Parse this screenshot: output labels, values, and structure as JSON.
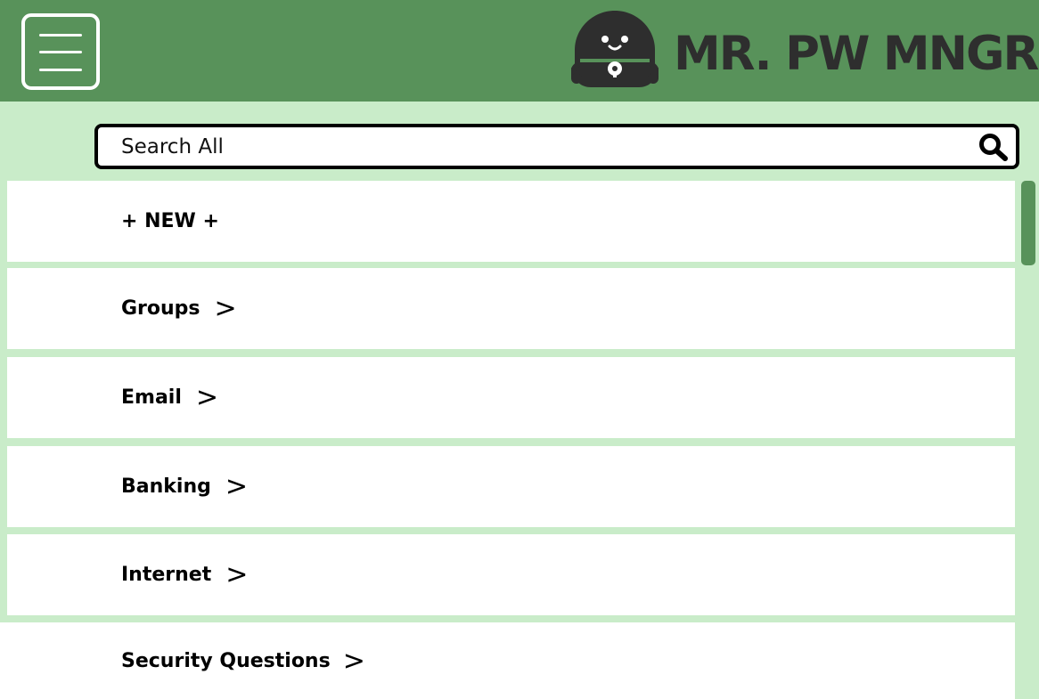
{
  "header": {
    "title": "MR. PW MNGR",
    "menu_icon": "hamburger-menu-icon",
    "logo_icon": "lock-mascot-icon",
    "background_color": "#58925a",
    "title_color": "#2e2e2e"
  },
  "search": {
    "placeholder": "Search All",
    "icon": "search-icon"
  },
  "list": {
    "items": [
      {
        "label": "+ NEW +",
        "chevron": ""
      },
      {
        "label": "Groups",
        "chevron": ">"
      },
      {
        "label": "Email",
        "chevron": ">"
      },
      {
        "label": "Banking",
        "chevron": ">"
      },
      {
        "label": "Internet",
        "chevron": ">"
      },
      {
        "label": "Security Questions",
        "chevron": ">"
      }
    ]
  },
  "colors": {
    "accent_green": "#58925a",
    "light_green": "#c9ecc9",
    "item_background": "#ffffff"
  }
}
